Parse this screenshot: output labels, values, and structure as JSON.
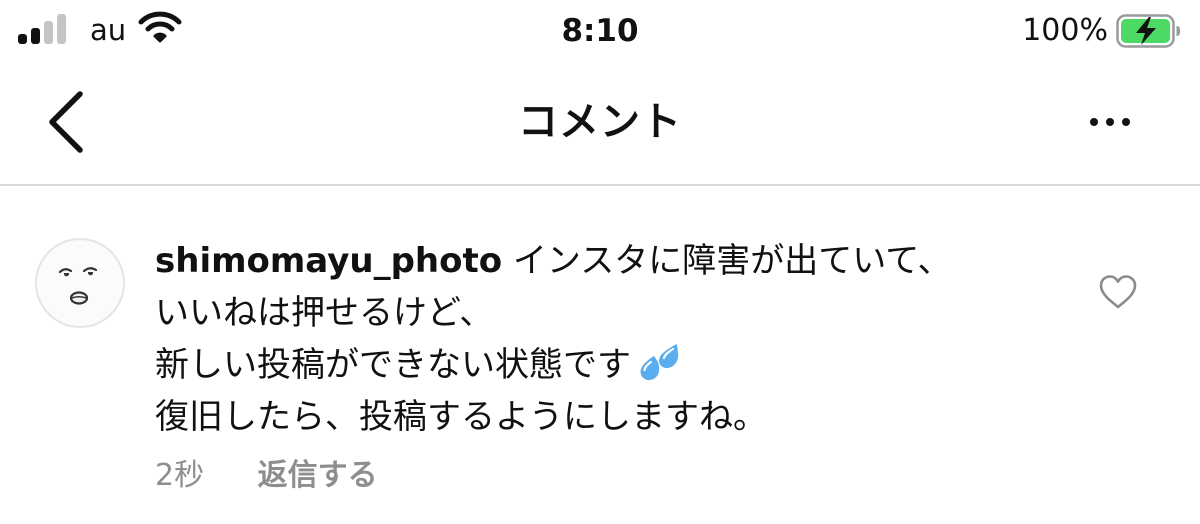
{
  "status_bar": {
    "carrier": "au",
    "time": "8:10",
    "battery_percent": "100%",
    "signal_bars_active": 2,
    "signal_bars_total": 4,
    "battery_level": 1.0,
    "battery_charging": true,
    "icons": {
      "signal": "cellular-signal-icon",
      "wifi": "wifi-icon",
      "battery": "battery-charging-icon"
    },
    "colors": {
      "battery_fill": "#4cd964"
    }
  },
  "header": {
    "title": "コメント",
    "icons": {
      "back": "chevron-left-icon",
      "more": "more-horizontal-icon"
    }
  },
  "comment": {
    "username": "shimomayu_photo",
    "text_lines": [
      "インスタに障害が出ていて、",
      "いいねは押せるけど、",
      "新しい投稿ができない状態です",
      "復旧したら、投稿するようにしますね。"
    ],
    "emoji": "💦",
    "time": "2秒",
    "reply_label": "返信する",
    "icons": {
      "avatar": "avatar-face-illustration",
      "like": "heart-outline-icon",
      "emoji": "sweat-droplets-icon"
    }
  },
  "colors": {
    "text_primary": "#111111",
    "text_secondary": "#8e8e8e",
    "divider": "#d8d8d8",
    "background": "#ffffff"
  }
}
